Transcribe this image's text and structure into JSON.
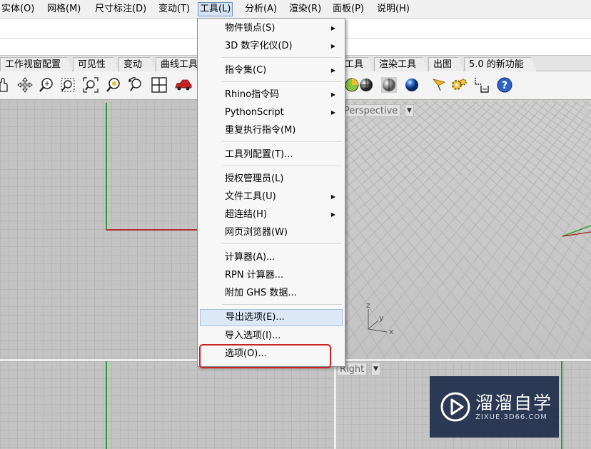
{
  "menubar": {
    "items": [
      {
        "label": "实体(O)"
      },
      {
        "label": "网格(M)"
      },
      {
        "label": "尺寸标注(D)"
      },
      {
        "label": "变动(T)"
      },
      {
        "label": "工具(L)"
      },
      {
        "label": "分析(A)"
      },
      {
        "label": "渲染(R)"
      },
      {
        "label": "面板(P)"
      },
      {
        "label": "说明(H)"
      }
    ]
  },
  "tabs": [
    {
      "label": "工作视窗配置"
    },
    {
      "label": "可见性"
    },
    {
      "label": "变动"
    },
    {
      "label": "曲线工具"
    },
    {
      "label": "工具"
    },
    {
      "label": "渲染工具"
    },
    {
      "label": "出图"
    },
    {
      "label": "5.0 的新功能"
    }
  ],
  "toolbar": {
    "icons": [
      "pan-hand-icon",
      "rotate-view-icon",
      "zoom-icon",
      "zoom-window-icon",
      "zoom-extents-icon",
      "zoom-selected-icon",
      "undo-view-icon",
      "four-viewports-icon",
      "car-render-icon",
      "render-sphere-icon",
      "shaded-sphere-icon",
      "ghosted-sphere-icon",
      "rendered-sphere-icon",
      "light-icon",
      "settings-gear-icon",
      "dimension-icon",
      "help-icon"
    ]
  },
  "viewports": {
    "perspective": {
      "label": "Perspective"
    },
    "right": {
      "label": "Right"
    },
    "axes": {
      "z": "z",
      "y": "y",
      "x": "x"
    }
  },
  "menu": {
    "items": [
      {
        "label": "物件锁点(S)",
        "submenu": true
      },
      {
        "label": "3D 数字化仪(D)",
        "submenu": true
      },
      {
        "label": "指令集(C)",
        "submenu": true
      },
      {
        "label": "Rhino指令码",
        "submenu": true
      },
      {
        "label": "PythonScript",
        "submenu": true
      },
      {
        "label": "重复执行指令(M)",
        "submenu": false
      },
      {
        "label": "工具列配置(T)...",
        "submenu": false
      },
      {
        "label": "授权管理员(L)",
        "submenu": false
      },
      {
        "label": "文件工具(U)",
        "submenu": true
      },
      {
        "label": "超连结(H)",
        "submenu": true
      },
      {
        "label": "网页浏览器(W)",
        "submenu": false
      },
      {
        "label": "计算器(A)...",
        "submenu": false
      },
      {
        "label": "RPN 计算器...",
        "submenu": false
      },
      {
        "label": "附加 GHS 数据...",
        "submenu": false
      },
      {
        "label": "导出选项(E)...",
        "submenu": false
      },
      {
        "label": "导入选项(I)...",
        "submenu": false
      },
      {
        "label": "选项(O)...",
        "submenu": false
      }
    ]
  },
  "watermark": {
    "title": "溜溜自学",
    "url": "ZIXUE.3D66.COM"
  },
  "colors": {
    "highlight": "#dde8f6",
    "annotation_red": "#cc2020",
    "axis_green": "#2f9a2f",
    "axis_red": "#b03030"
  }
}
